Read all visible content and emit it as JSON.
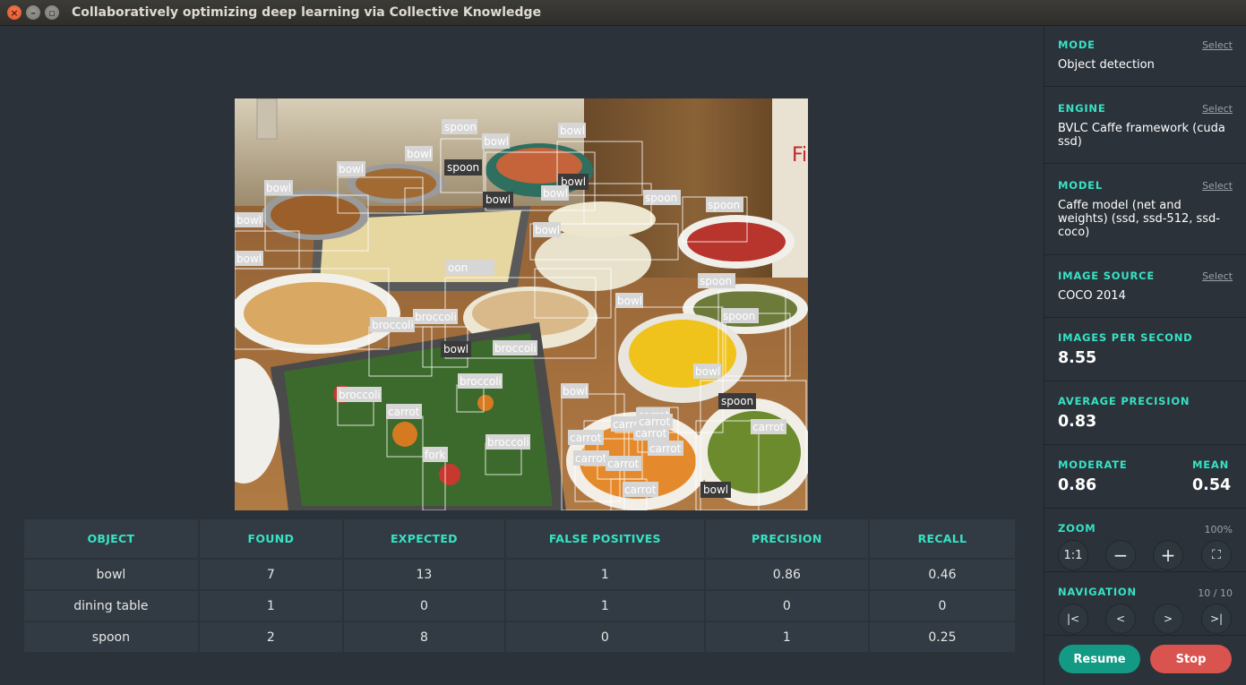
{
  "window": {
    "title": "Collaboratively optimizing deep learning via Collective Knowledge"
  },
  "table": {
    "headers": [
      "OBJECT",
      "FOUND",
      "EXPECTED",
      "FALSE POSITIVES",
      "PRECISION",
      "RECALL"
    ],
    "rows": [
      [
        "bowl",
        "7",
        "13",
        "1",
        "0.86",
        "0.46"
      ],
      [
        "dining table",
        "1",
        "0",
        "1",
        "0",
        "0"
      ],
      [
        "spoon",
        "2",
        "8",
        "0",
        "1",
        "0.25"
      ]
    ]
  },
  "detections": {
    "visible_labels": [
      "spoon",
      "bowl",
      "bowl",
      "spoon",
      "bowl",
      "bowl",
      "bowl",
      "bowl",
      "bowl",
      "bowl",
      "spoon",
      "spoon",
      "bowl",
      "bowl",
      "bowl",
      "oon",
      "spoon",
      "broccoli",
      "broccoli",
      "bowl",
      "spoon",
      "broccoli",
      "broccoli",
      "bowl",
      "broccoli",
      "bowl",
      "bowl",
      "spoon",
      "carrot",
      "carrot",
      "carrot",
      "carrot",
      "carrot",
      "carrot",
      "carrot",
      "carrot",
      "carrot",
      "fork",
      "broccoli",
      "carrot",
      "bowl",
      "carrot"
    ]
  },
  "sidebar": {
    "mode": {
      "label": "MODE",
      "select": "Select",
      "value": "Object detection"
    },
    "engine": {
      "label": "ENGINE",
      "select": "Select",
      "value": "BVLC Caffe framework (cuda ssd)"
    },
    "model": {
      "label": "MODEL",
      "select": "Select",
      "value": "Caffe model (net and weights) (ssd, ssd-512, ssd-coco)"
    },
    "image_source": {
      "label": "IMAGE SOURCE",
      "select": "Select",
      "value": "COCO 2014"
    },
    "ips": {
      "label": "IMAGES PER SECOND",
      "value": "8.55"
    },
    "avg_precision": {
      "label": "AVERAGE PRECISION",
      "value": "0.83"
    },
    "moderate": {
      "label": "MODERATE",
      "value": "0.86"
    },
    "mean": {
      "label": "MEAN",
      "value": "0.54"
    },
    "zoom": {
      "label": "ZOOM",
      "level": "100%",
      "buttons": [
        "1:1",
        "−",
        "+",
        "⛶"
      ]
    },
    "navigation": {
      "label": "NAVIGATION",
      "position": "10 / 10",
      "buttons": [
        "|<",
        "<",
        ">",
        ">|"
      ]
    },
    "actions": {
      "resume": "Resume",
      "stop": "Stop"
    }
  },
  "colors": {
    "accent": "#37e2c4",
    "resume": "#139a84",
    "stop": "#d9534f",
    "panel": "#323b43",
    "background": "#2b3239"
  }
}
